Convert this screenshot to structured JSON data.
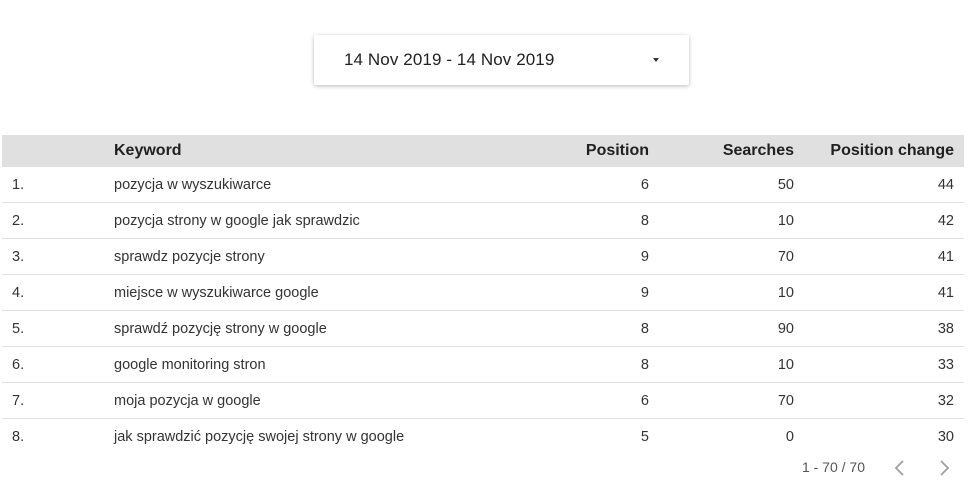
{
  "date_range": {
    "label": "14 Nov 2019 - 14 Nov 2019"
  },
  "table": {
    "headers": {
      "index": "",
      "keyword": "Keyword",
      "position": "Position",
      "searches": "Searches",
      "position_change": "Position change"
    },
    "rows": [
      {
        "index": "1.",
        "keyword": "pozycja w wyszukiwarce",
        "position": "6",
        "searches": "50",
        "position_change": "44"
      },
      {
        "index": "2.",
        "keyword": "pozycja strony w google jak sprawdzic",
        "position": "8",
        "searches": "10",
        "position_change": "42"
      },
      {
        "index": "3.",
        "keyword": "sprawdz pozycje strony",
        "position": "9",
        "searches": "70",
        "position_change": "41"
      },
      {
        "index": "4.",
        "keyword": "miejsce w wyszukiwarce google",
        "position": "9",
        "searches": "10",
        "position_change": "41"
      },
      {
        "index": "5.",
        "keyword": "sprawdź pozycję strony w google",
        "position": "8",
        "searches": "90",
        "position_change": "38"
      },
      {
        "index": "6.",
        "keyword": "google monitoring stron",
        "position": "8",
        "searches": "10",
        "position_change": "33"
      },
      {
        "index": "7.",
        "keyword": "moja pozycja w google",
        "position": "6",
        "searches": "70",
        "position_change": "32"
      },
      {
        "index": "8.",
        "keyword": "jak sprawdzić pozycję swojej strony w google",
        "position": "5",
        "searches": "0",
        "position_change": "30"
      }
    ]
  },
  "pagination": {
    "range_label": "1 - 70 / 70",
    "prev_icon": "chevron-left-icon",
    "next_icon": "chevron-right-icon"
  },
  "colors": {
    "header_bg": "#e0e0e0",
    "divider": "#e0e0e0",
    "text": "#333333",
    "icon_disabled": "#9e9e9e"
  }
}
